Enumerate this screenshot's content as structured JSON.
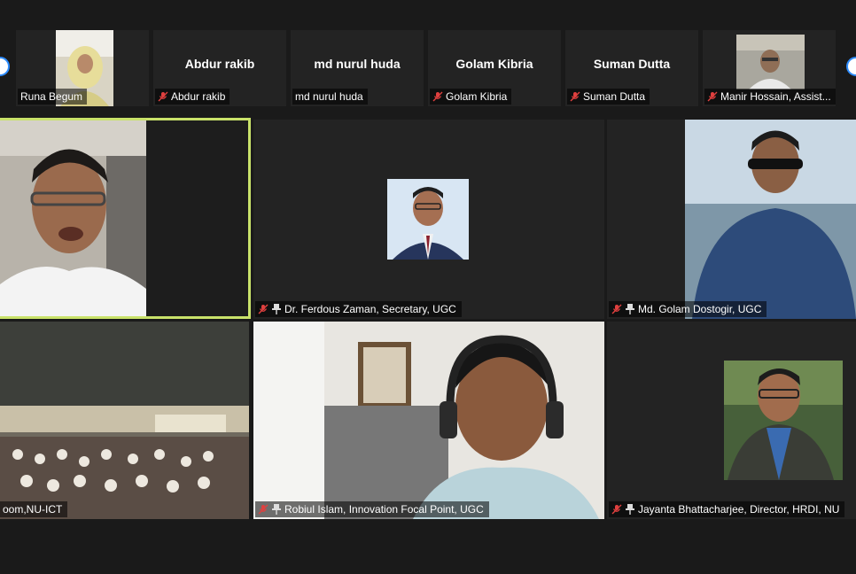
{
  "strip": [
    {
      "name": "Runa Begum",
      "label": "Runa Begum",
      "muted": false,
      "has_video": true
    },
    {
      "name": "Abdur rakib",
      "label": "Abdur rakib",
      "muted": true,
      "has_video": false
    },
    {
      "name": "md nurul huda",
      "label": "md nurul huda",
      "muted": false,
      "has_video": false
    },
    {
      "name": "Golam Kibria",
      "label": "Golam Kibria",
      "muted": true,
      "has_video": false
    },
    {
      "name": "Suman Dutta",
      "label": "Suman Dutta",
      "muted": true,
      "has_video": false
    },
    {
      "name": "Manir Hossain",
      "label": "Manir Hossain, Assist...",
      "muted": true,
      "has_video": true
    }
  ],
  "grid": [
    {
      "label": "",
      "speaking": true
    },
    {
      "label": "Dr. Ferdous Zaman, Secretary, UGC"
    },
    {
      "label": "Md. Golam Dostogir, UGC"
    },
    {
      "label": "oom,NU-ICT"
    },
    {
      "label": "Robiul Islam, Innovation Focal Point, UGC"
    },
    {
      "label": "Jayanta Bhattacharjee, Director, HRDI, NU"
    }
  ],
  "icons": {
    "muted": "mic-off-icon",
    "pinned": "pin-icon"
  },
  "colors": {
    "speaking_border": "#c9e26a",
    "tile": "#232323",
    "background": "#1a1a1a"
  }
}
